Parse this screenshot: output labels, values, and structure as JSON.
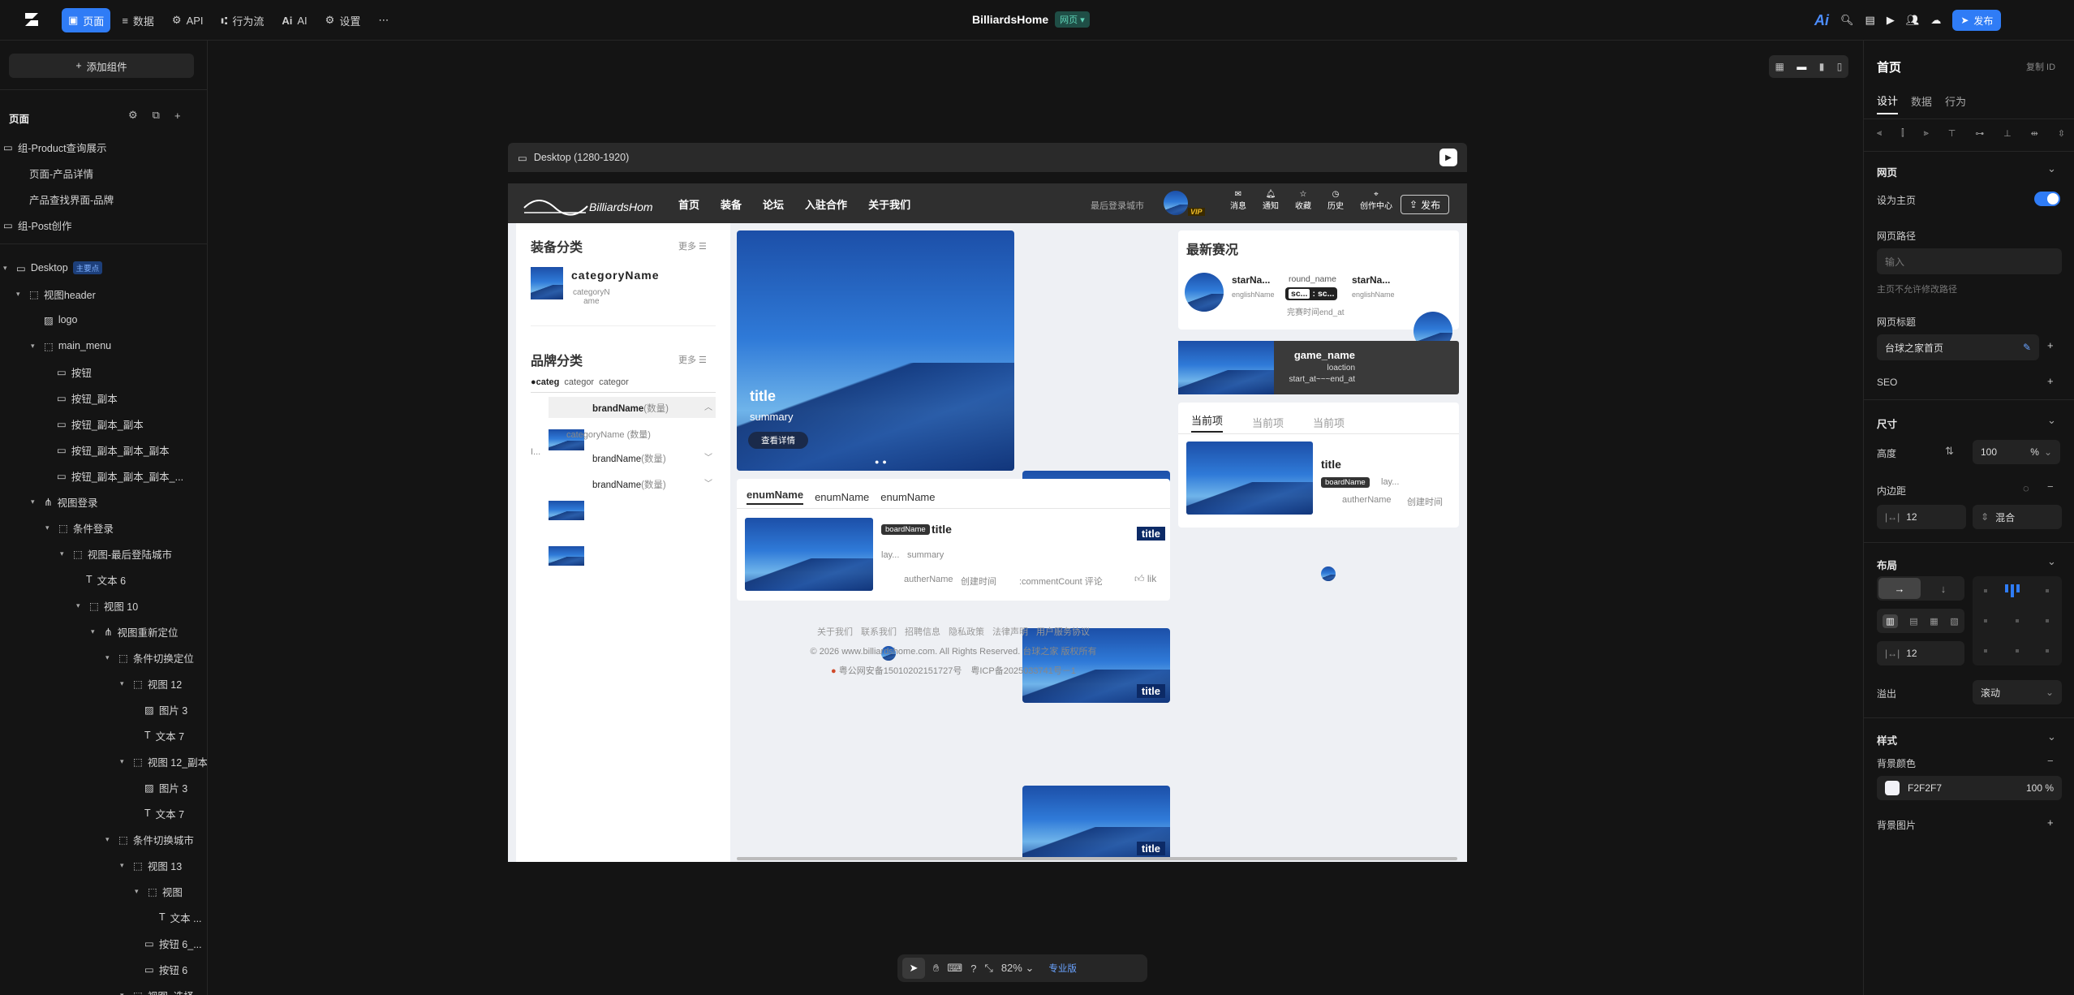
{
  "topbar": {
    "menu": [
      {
        "label": "页面",
        "icon": "page-icon"
      },
      {
        "label": "数据",
        "icon": "database-icon"
      },
      {
        "label": "API",
        "icon": "api-icon"
      },
      {
        "label": "行为流",
        "icon": "flow-icon"
      },
      {
        "label": "AI",
        "icon": "ai-icon"
      },
      {
        "label": "设置",
        "icon": "gear-icon"
      }
    ],
    "title": "BilliardsHome",
    "title_badge": "网页",
    "publish": "发布",
    "accent": "#2f7cf6"
  },
  "left": {
    "add_component": "添加组件",
    "pages_title": "页面",
    "pages": [
      "组-Product查询展示",
      "页面-产品详情",
      "产品查找界面-品牌",
      "组-Post创作"
    ],
    "tree": [
      {
        "label": "Desktop",
        "badge": "主要点"
      },
      {
        "label": "视图header"
      },
      {
        "label": "logo"
      },
      {
        "label": "main_menu"
      },
      {
        "label": "按钮"
      },
      {
        "label": "按钮_副本"
      },
      {
        "label": "按钮_副本_副本"
      },
      {
        "label": "按钮_副本_副本_副本"
      },
      {
        "label": "按钮_副本_副本_副本_..."
      },
      {
        "label": "视图登录"
      },
      {
        "label": "条件登录"
      },
      {
        "label": "视图-最后登陆城市"
      },
      {
        "label": "文本 6"
      },
      {
        "label": "视图 10"
      },
      {
        "label": "视图重新定位"
      },
      {
        "label": "条件切换定位"
      },
      {
        "label": "视图 12"
      },
      {
        "label": "图片 3"
      },
      {
        "label": "文本 7"
      },
      {
        "label": "视图 12_副本"
      },
      {
        "label": "图片 3"
      },
      {
        "label": "文本 7"
      },
      {
        "label": "条件切换城市"
      },
      {
        "label": "视图 13"
      },
      {
        "label": "视图"
      },
      {
        "label": "文本 ..."
      },
      {
        "label": "按钮 6_..."
      },
      {
        "label": "按钮 6"
      },
      {
        "label": "视图_选择..."
      }
    ]
  },
  "canvas": {
    "viewport_label": "Desktop (1280-1920)",
    "zoom": "82%",
    "pro_label": "专业版"
  },
  "site": {
    "nav": [
      "首页",
      "装备",
      "论坛",
      "入驻合作",
      "关于我们"
    ],
    "last_city": "最后登录城市",
    "vip": "VIP",
    "icons": [
      {
        "label": "消息",
        "icon": "message-icon"
      },
      {
        "label": "通知",
        "icon": "bell-icon"
      },
      {
        "label": "收藏",
        "icon": "star-icon"
      },
      {
        "label": "历史",
        "icon": "history-icon"
      },
      {
        "label": "创作中心",
        "icon": "location-icon"
      }
    ],
    "publish": "发布",
    "equip_title": "装备分类",
    "more": "更多",
    "category_name": "categoryName",
    "category_sub": "categoryN\name",
    "brand_title": "品牌分类",
    "brand_tabs": [
      "categ",
      "categor",
      "categor"
    ],
    "brands": [
      {
        "name": "brandName",
        "count": "(数量)"
      },
      {
        "name": "brandName",
        "count": "(数量)"
      },
      {
        "name": "brandName",
        "count": "(数量)"
      }
    ],
    "brand_sub": "categoryName (数量)",
    "brand_side": "I...",
    "hero_title": "title",
    "hero_summary": "summary",
    "hero_btn": "查看详情",
    "thumb_title": "title",
    "news_title": "最新赛况",
    "match": {
      "p1": "starNa...",
      "p1_en": "englishName",
      "round": "round_name",
      "s1": "sc...",
      "colon": ":",
      "s2": "sc...",
      "time": "完赛时间end_at",
      "p2": "starNa...",
      "p2_en": "englishName"
    },
    "game": {
      "name": "game_name",
      "loc": "loaction",
      "time": "start_at~~~end_at"
    },
    "tabs2": [
      "当前项",
      "当前项",
      "当前项"
    ],
    "post2": {
      "title": "title",
      "board": "boardName",
      "lay": "lay...",
      "author": "autherName",
      "time": "创建时间"
    },
    "enum_tabs": [
      "enumName",
      "enumName",
      "enumName"
    ],
    "post": {
      "board": "boardName",
      "title": "title",
      "lay": "lay...",
      "summary": "summary",
      "author": "autherName",
      "time": "创建时间",
      "comments": ":commentCount 评论",
      "like": "lik"
    },
    "footer": {
      "links": [
        "关于我们",
        "联系我们",
        "招聘信息",
        "隐私政策",
        "法律声明",
        "用户服务协议"
      ],
      "copy": "© 2026 www.billiardshome.com. All Rights Reserved.",
      "copy2": "台球之家 版权所有",
      "icp": "粤公网安备15010202151727号",
      "icp2": "粤ICP备2025033741号－1"
    }
  },
  "right": {
    "title": "首页",
    "copy_id": "复制 ID",
    "tabs": [
      "设计",
      "数据",
      "行为"
    ],
    "webpage": "网页",
    "set_home": "设为主页",
    "path_label": "网页路径",
    "path_placeholder": "输入",
    "path_note": "主页不允许修改路径",
    "page_title_label": "网页标题",
    "page_title_value": "台球之家首页",
    "seo": "SEO",
    "size": "尺寸",
    "height": "高度",
    "height_value": "100",
    "height_unit": "%",
    "padding": "内边距",
    "padding_value": "12",
    "mixed": "混合",
    "layout": "布局",
    "gap_value": "12",
    "overflow": "溢出",
    "overflow_value": "滚动",
    "style": "样式",
    "bg_color": "背景颜色",
    "bg_color_value": "F2F2F7",
    "bg_opacity": "100 %",
    "bg_image": "背景图片"
  }
}
